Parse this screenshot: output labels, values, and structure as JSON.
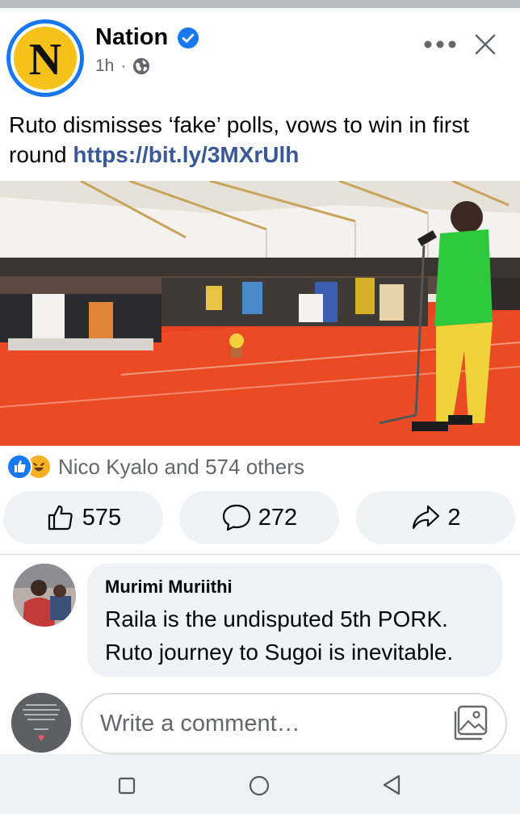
{
  "post": {
    "page_name": "Nation",
    "avatar_letter": "N",
    "time": "1h",
    "separator": "·",
    "text": "Ruto dismisses ‘fake’ polls, vows to win in first round ",
    "link": "https://bit.ly/3MXrUlh",
    "photo_icon": "speech-photo"
  },
  "reactions": {
    "summary": "Nico Kyalo and 574 others",
    "icons": [
      "like-reaction-icon",
      "haha-reaction-icon"
    ]
  },
  "actions": {
    "like_count": "575",
    "comment_count": "272",
    "share_count": "2"
  },
  "comment": {
    "author": "Murimi Muriithi",
    "body_line1": "Raila is the undisputed 5th PORK.",
    "body_line2": "Ruto journey to Sugoi is inevitable."
  },
  "composer": {
    "placeholder": "Write a comment…"
  },
  "colors": {
    "brand_blue": "#1877f2",
    "link": "#385898",
    "secondary_text": "#65676b",
    "bubble": "#f0f2f5"
  }
}
